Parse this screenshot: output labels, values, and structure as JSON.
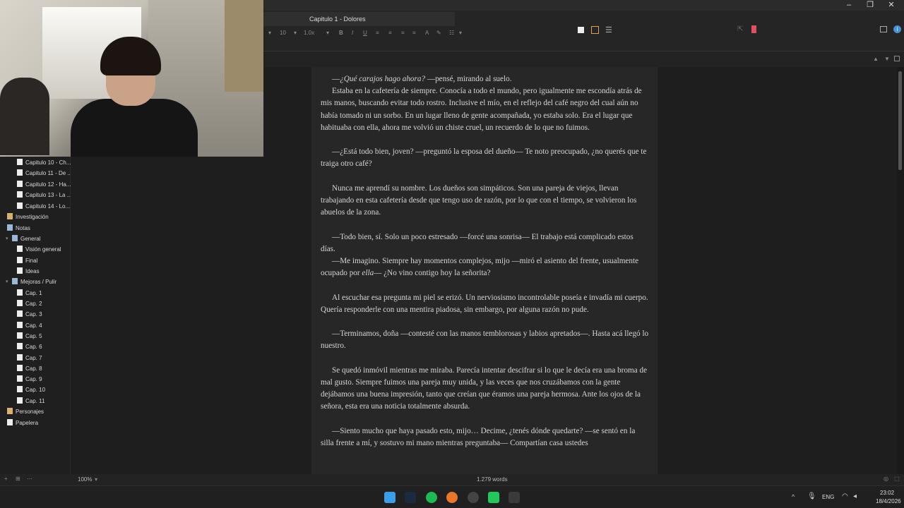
{
  "document": {
    "tab_title": "Capitulo 1 - Dolores",
    "font_size": "10",
    "line_spacing": "1.0x",
    "zoom": "100%",
    "word_count": "1.279 words"
  },
  "sidebar": {
    "items": [
      {
        "label": "Capitulo 10 - Ch...",
        "level": 2,
        "icon": "page"
      },
      {
        "label": "Capitulo 11 - De ...",
        "level": 2,
        "icon": "page"
      },
      {
        "label": "Capitulo 12 - Ha...",
        "level": 2,
        "icon": "page"
      },
      {
        "label": "Capitulo 13 - La ...",
        "level": 2,
        "icon": "page"
      },
      {
        "label": "Capitulo 14 - Lo...",
        "level": 2,
        "icon": "page"
      },
      {
        "label": "Investigación",
        "level": 0,
        "icon": "folder-yellow"
      },
      {
        "label": "Notas",
        "level": 0,
        "icon": "folder"
      },
      {
        "label": "General",
        "level": 1,
        "icon": "folder"
      },
      {
        "label": "Visión general",
        "level": 2,
        "icon": "page"
      },
      {
        "label": "Final",
        "level": 2,
        "icon": "page"
      },
      {
        "label": "Ideas",
        "level": 2,
        "icon": "page"
      },
      {
        "label": "Mejoras / Pulir",
        "level": 1,
        "icon": "folder"
      },
      {
        "label": "Cap. 1",
        "level": 2,
        "icon": "page"
      },
      {
        "label": "Cap. 2",
        "level": 2,
        "icon": "page"
      },
      {
        "label": "Cap. 3",
        "level": 2,
        "icon": "page"
      },
      {
        "label": "Cap. 4",
        "level": 2,
        "icon": "page"
      },
      {
        "label": "Cap. 5",
        "level": 2,
        "icon": "page"
      },
      {
        "label": "Cap. 6",
        "level": 2,
        "icon": "page"
      },
      {
        "label": "Cap. 7",
        "level": 2,
        "icon": "page"
      },
      {
        "label": "Cap. 8",
        "level": 2,
        "icon": "page"
      },
      {
        "label": "Cap. 9",
        "level": 2,
        "icon": "page"
      },
      {
        "label": "Cap. 10",
        "level": 2,
        "icon": "page"
      },
      {
        "label": "Cap. 11",
        "level": 2,
        "icon": "page"
      },
      {
        "label": "Personajes",
        "level": 0,
        "icon": "folder-yellow"
      },
      {
        "label": "Papelera",
        "level": 0,
        "icon": "trash"
      }
    ]
  },
  "text": {
    "p1a": "—",
    "p1b": "¿Qué carajos hago ahora?",
    "p1c": " —pensé, mirando al suelo.",
    "p2": "Estaba en la cafetería de siempre. Conocía a todo el mundo, pero igualmente me escondía atrás de mis manos, buscando evitar todo rostro. Inclusive el mío, en el reflejo del café negro del cual aún no había tomado ni un sorbo. En un lugar lleno de gente acompañada, yo estaba solo. Era el lugar que habituaba con ella, ahora me volvió un chiste cruel, un recuerdo de lo que no fuimos.",
    "p3": "—¿Está todo bien, joven? —preguntó la esposa del dueño— Te noto preocupado, ¿no querés que te traiga otro café?",
    "p4": "Nunca me aprendí su nombre. Los dueños son simpáticos. Son una pareja de viejos, llevan trabajando en esta cafetería desde que tengo uso de razón, por lo que con el tiempo, se volvieron los abuelos de la zona.",
    "p5": "—Todo bien, sí. Solo un poco estresado —forcé una sonrisa— El trabajo está complicado estos días.",
    "p6a": "—Me imagino. Siempre hay momentos complejos, mijo —miró el asiento del frente, usualmente ocupado por ",
    "p6b": "ella",
    "p6c": "— ¿No vino contigo hoy la señorita?",
    "p7": "Al escuchar esa pregunta mi piel se erizó. Un nerviosismo incontrolable poseía e invadía mi cuerpo. Quería responderle con una mentira piadosa, sin embargo, por alguna razón no pude.",
    "p8": "—Terminamos, doña —contesté con las manos temblorosas y labios apretados—. Hasta acá llegó lo nuestro.",
    "p9": "Se quedó inmóvil mientras me miraba. Parecía intentar descifrar si lo que le decía era una broma de mal gusto. Siempre fuimos una pareja muy unida, y las veces que nos cruzábamos con la gente dejábamos una buena impresión, tanto que creían que éramos una pareja hermosa. Ante los ojos de la señora, esta era una noticia totalmente absurda.",
    "p10": "—Siento mucho que haya pasado esto, mijo… Decime, ¿tenés dónde quedarte? —se sentó en la silla frente a mí, y sostuvo mi mano mientras preguntaba— Compartían casa ustedes"
  },
  "taskbar": {
    "language": "ENG",
    "time": "23:02",
    "date": "18/4/2026"
  }
}
